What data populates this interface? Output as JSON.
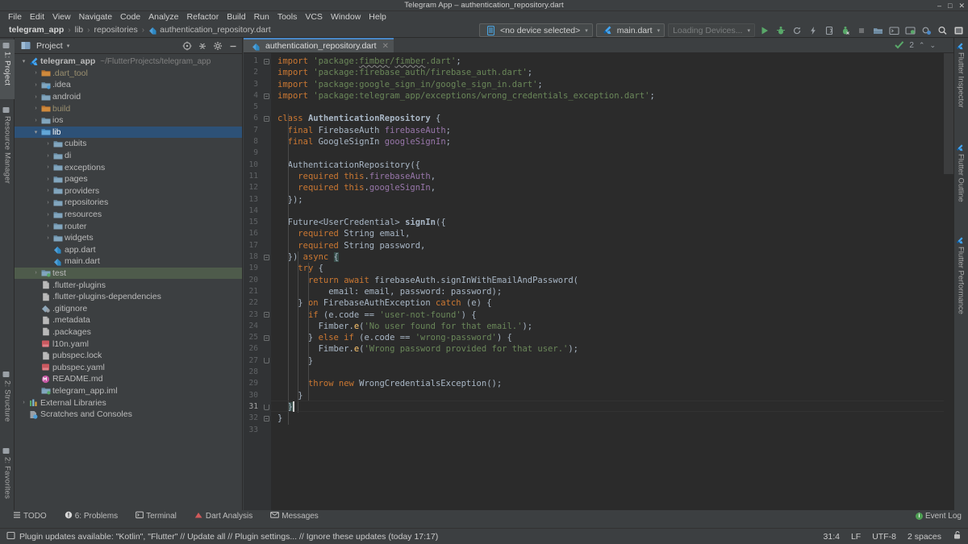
{
  "window": {
    "title": "Telegram App – authentication_repository.dart",
    "controls": [
      "–",
      "□",
      "✕"
    ]
  },
  "menubar": {
    "items": [
      "File",
      "Edit",
      "View",
      "Navigate",
      "Code",
      "Analyze",
      "Refactor",
      "Build",
      "Run",
      "Tools",
      "VCS",
      "Window",
      "Help"
    ]
  },
  "breadcrumb": {
    "items": [
      "telegram_app",
      "lib",
      "repositories",
      "authentication_repository.dart"
    ],
    "separator": "›"
  },
  "toolbar": {
    "device_selector": "<no device selected>",
    "run_config": "main.dart",
    "loading_devices": "Loading Devices...",
    "icons": [
      "run-icon",
      "debug-icon",
      "hot-reload-icon",
      "hot-restart-icon",
      "open-devtools-icon",
      "stop-profile-icon",
      "stop-icon",
      "build-icon",
      "terminal-icon",
      "android-device-icon",
      "settings-sync-icon",
      "search-everywhere-icon",
      "project-structure-icon"
    ],
    "caret": "▾"
  },
  "left_tool_strip": {
    "top": [
      {
        "label": "1: Project",
        "icon": "project-icon",
        "selected": true
      },
      {
        "label": "Resource Manager",
        "icon": "resource-manager-icon",
        "selected": false
      }
    ],
    "bottom": [
      {
        "label": "2: Structure",
        "icon": "structure-icon"
      },
      {
        "label": "2: Favorites",
        "icon": "star-icon"
      }
    ]
  },
  "right_tool_strip": {
    "items": [
      {
        "label": "Flutter Inspector",
        "icon": "flutter-icon"
      },
      {
        "label": "Flutter Outline",
        "icon": "flutter-icon"
      },
      {
        "label": "Flutter Performance",
        "icon": "flutter-icon"
      }
    ]
  },
  "project_panel": {
    "title": "Project",
    "caret": "▾",
    "header_icons": [
      "locate-icon",
      "collapse-all-icon",
      "settings-gear-icon",
      "hide-icon"
    ],
    "tree": [
      {
        "indent": 0,
        "arrow": "▾",
        "icon": "flutter-icon",
        "label": "telegram_app",
        "bold": true,
        "sub": "~/FlutterProjects/telegram_app",
        "state": "none"
      },
      {
        "indent": 1,
        "arrow": "›",
        "icon": "folder-excluded-icon",
        "label": ".dart_tool",
        "dim": true,
        "state": "none"
      },
      {
        "indent": 1,
        "arrow": "›",
        "icon": "folder-idea-icon",
        "label": ".idea",
        "state": "none"
      },
      {
        "indent": 1,
        "arrow": "›",
        "icon": "folder-icon",
        "label": "android",
        "state": "none"
      },
      {
        "indent": 1,
        "arrow": "›",
        "icon": "folder-excluded-icon",
        "label": "build",
        "dim": true,
        "state": "none"
      },
      {
        "indent": 1,
        "arrow": "›",
        "icon": "folder-icon",
        "label": "ios",
        "state": "none"
      },
      {
        "indent": 1,
        "arrow": "▾",
        "icon": "folder-source-icon",
        "label": "lib",
        "state": "selected"
      },
      {
        "indent": 2,
        "arrow": "›",
        "icon": "folder-icon",
        "label": "cubits",
        "state": "none"
      },
      {
        "indent": 2,
        "arrow": "›",
        "icon": "folder-icon",
        "label": "di",
        "state": "none"
      },
      {
        "indent": 2,
        "arrow": "›",
        "icon": "folder-icon",
        "label": "exceptions",
        "state": "none"
      },
      {
        "indent": 2,
        "arrow": "›",
        "icon": "folder-icon",
        "label": "pages",
        "state": "none"
      },
      {
        "indent": 2,
        "arrow": "›",
        "icon": "folder-icon",
        "label": "providers",
        "state": "none"
      },
      {
        "indent": 2,
        "arrow": "›",
        "icon": "folder-icon",
        "label": "repositories",
        "state": "none"
      },
      {
        "indent": 2,
        "arrow": "›",
        "icon": "folder-icon",
        "label": "resources",
        "state": "none"
      },
      {
        "indent": 2,
        "arrow": "›",
        "icon": "folder-icon",
        "label": "router",
        "state": "none"
      },
      {
        "indent": 2,
        "arrow": "›",
        "icon": "folder-icon",
        "label": "widgets",
        "state": "none"
      },
      {
        "indent": 2,
        "arrow": "",
        "icon": "dart-file-icon",
        "label": "app.dart",
        "state": "none"
      },
      {
        "indent": 2,
        "arrow": "",
        "icon": "dart-file-icon",
        "label": "main.dart",
        "state": "none"
      },
      {
        "indent": 1,
        "arrow": "›",
        "icon": "folder-test-icon",
        "label": "test",
        "state": "hover"
      },
      {
        "indent": 1,
        "arrow": "",
        "icon": "text-file-icon",
        "label": ".flutter-plugins",
        "state": "none"
      },
      {
        "indent": 1,
        "arrow": "",
        "icon": "text-file-icon",
        "label": ".flutter-plugins-dependencies",
        "state": "none"
      },
      {
        "indent": 1,
        "arrow": "",
        "icon": "gitignore-icon",
        "label": ".gitignore",
        "state": "none"
      },
      {
        "indent": 1,
        "arrow": "",
        "icon": "text-file-icon",
        "label": ".metadata",
        "state": "none"
      },
      {
        "indent": 1,
        "arrow": "",
        "icon": "text-file-icon",
        "label": ".packages",
        "state": "none"
      },
      {
        "indent": 1,
        "arrow": "",
        "icon": "yaml-file-icon",
        "label": "l10n.yaml",
        "state": "none"
      },
      {
        "indent": 1,
        "arrow": "",
        "icon": "text-file-icon",
        "label": "pubspec.lock",
        "state": "none"
      },
      {
        "indent": 1,
        "arrow": "",
        "icon": "yaml-file-icon",
        "label": "pubspec.yaml",
        "state": "none"
      },
      {
        "indent": 1,
        "arrow": "",
        "icon": "markdown-file-icon",
        "label": "README.md",
        "state": "none"
      },
      {
        "indent": 1,
        "arrow": "",
        "icon": "iml-file-icon",
        "label": "telegram_app.iml",
        "state": "none"
      },
      {
        "indent": 0,
        "arrow": "›",
        "icon": "libraries-icon",
        "label": "External Libraries",
        "state": "none"
      },
      {
        "indent": 0,
        "arrow": "",
        "icon": "scratches-icon",
        "label": "Scratches and Consoles",
        "state": "none"
      }
    ]
  },
  "editor": {
    "tab": {
      "label": "authentication_repository.dart",
      "icon": "dart-file-icon",
      "close": "✕"
    },
    "inspections": {
      "status_icon": "inspections-ok-icon",
      "count": "2",
      "up": "⌃",
      "down": "⌄"
    },
    "first_line": 1,
    "last_line": 33,
    "lines": [
      {
        "n": 1,
        "tokens": [
          {
            "c": "k",
            "t": "import "
          },
          {
            "c": "s",
            "t": "'package:"
          },
          {
            "c": "s und",
            "t": "fimber"
          },
          {
            "c": "s",
            "t": "/"
          },
          {
            "c": "s und",
            "t": "fimber"
          },
          {
            "c": "s",
            "t": ".dart'"
          },
          {
            "c": "t",
            "t": ";"
          }
        ]
      },
      {
        "n": 2,
        "tokens": [
          {
            "c": "k",
            "t": "import "
          },
          {
            "c": "s",
            "t": "'package:firebase_auth/firebase_auth.dart'"
          },
          {
            "c": "t",
            "t": ";"
          }
        ]
      },
      {
        "n": 3,
        "tokens": [
          {
            "c": "k",
            "t": "import "
          },
          {
            "c": "s",
            "t": "'package:google_sign_in/google_sign_in.dart'"
          },
          {
            "c": "t",
            "t": ";"
          }
        ]
      },
      {
        "n": 4,
        "tokens": [
          {
            "c": "k",
            "t": "import "
          },
          {
            "c": "s",
            "t": "'package:telegram_app/exceptions/wrong_credentials_exception.dart'"
          },
          {
            "c": "t",
            "t": ";"
          }
        ]
      },
      {
        "n": 5,
        "tokens": []
      },
      {
        "n": 6,
        "tokens": [
          {
            "c": "k",
            "t": "class "
          },
          {
            "c": "cls",
            "t": "AuthenticationRepository"
          },
          {
            "c": "t",
            "t": " {"
          }
        ]
      },
      {
        "n": 7,
        "tokens": [
          {
            "c": "t",
            "t": "  "
          },
          {
            "c": "k",
            "t": "final "
          },
          {
            "c": "ty",
            "t": "FirebaseAuth "
          },
          {
            "c": "fd",
            "t": "firebaseAuth"
          },
          {
            "c": "t",
            "t": ";"
          }
        ]
      },
      {
        "n": 8,
        "tokens": [
          {
            "c": "t",
            "t": "  "
          },
          {
            "c": "k",
            "t": "final "
          },
          {
            "c": "ty",
            "t": "GoogleSignIn "
          },
          {
            "c": "fd",
            "t": "googleSignIn"
          },
          {
            "c": "t",
            "t": ";"
          }
        ]
      },
      {
        "n": 9,
        "tokens": []
      },
      {
        "n": 10,
        "tokens": [
          {
            "c": "t",
            "t": "  AuthenticationRepository({"
          }
        ]
      },
      {
        "n": 11,
        "tokens": [
          {
            "c": "t",
            "t": "    "
          },
          {
            "c": "k",
            "t": "required "
          },
          {
            "c": "k",
            "t": "this"
          },
          {
            "c": "t",
            "t": "."
          },
          {
            "c": "fd",
            "t": "firebaseAuth"
          },
          {
            "c": "t",
            "t": ","
          }
        ]
      },
      {
        "n": 12,
        "tokens": [
          {
            "c": "t",
            "t": "    "
          },
          {
            "c": "k",
            "t": "required "
          },
          {
            "c": "k",
            "t": "this"
          },
          {
            "c": "t",
            "t": "."
          },
          {
            "c": "fd",
            "t": "googleSignIn"
          },
          {
            "c": "t",
            "t": ","
          }
        ]
      },
      {
        "n": 13,
        "tokens": [
          {
            "c": "t",
            "t": "  });"
          }
        ]
      },
      {
        "n": 14,
        "tokens": []
      },
      {
        "n": 15,
        "tokens": [
          {
            "c": "t",
            "t": "  "
          },
          {
            "c": "ty",
            "t": "Future<UserCredential> "
          },
          {
            "c": "cls",
            "t": "signIn"
          },
          {
            "c": "t",
            "t": "({"
          }
        ]
      },
      {
        "n": 16,
        "tokens": [
          {
            "c": "t",
            "t": "    "
          },
          {
            "c": "k",
            "t": "required "
          },
          {
            "c": "ty",
            "t": "String "
          },
          {
            "c": "t",
            "t": "email,"
          }
        ]
      },
      {
        "n": 17,
        "tokens": [
          {
            "c": "t",
            "t": "    "
          },
          {
            "c": "k",
            "t": "required "
          },
          {
            "c": "ty",
            "t": "String "
          },
          {
            "c": "t",
            "t": "password,"
          }
        ]
      },
      {
        "n": 18,
        "tokens": [
          {
            "c": "t",
            "t": "  }) "
          },
          {
            "c": "k",
            "t": "async "
          },
          {
            "c": "brgreen",
            "t": "{"
          }
        ]
      },
      {
        "n": 19,
        "tokens": [
          {
            "c": "t",
            "t": "    "
          },
          {
            "c": "k",
            "t": "try"
          },
          {
            "c": "t",
            "t": " {"
          }
        ]
      },
      {
        "n": 20,
        "tokens": [
          {
            "c": "t",
            "t": "      "
          },
          {
            "c": "k",
            "t": "return "
          },
          {
            "c": "k",
            "t": "await "
          },
          {
            "c": "t",
            "t": "firebaseAuth.signInWithEmailAndPassword("
          }
        ]
      },
      {
        "n": 21,
        "tokens": [
          {
            "c": "t",
            "t": "          email: email, password: password);"
          }
        ]
      },
      {
        "n": 22,
        "tokens": [
          {
            "c": "t",
            "t": "    } "
          },
          {
            "c": "k",
            "t": "on "
          },
          {
            "c": "t",
            "t": "FirebaseAuthException "
          },
          {
            "c": "k",
            "t": "catch "
          },
          {
            "c": "t",
            "t": "(e) {"
          }
        ]
      },
      {
        "n": 23,
        "tokens": [
          {
            "c": "t",
            "t": "      "
          },
          {
            "c": "k",
            "t": "if "
          },
          {
            "c": "t",
            "t": "(e.code == "
          },
          {
            "c": "s",
            "t": "'user-not-found'"
          },
          {
            "c": "t",
            "t": ") {"
          }
        ]
      },
      {
        "n": 24,
        "tokens": [
          {
            "c": "t",
            "t": "        Fimber."
          },
          {
            "c": "fn",
            "t": "e"
          },
          {
            "c": "t",
            "t": "("
          },
          {
            "c": "s",
            "t": "'No user found for that email.'"
          },
          {
            "c": "t",
            "t": ");"
          }
        ]
      },
      {
        "n": 25,
        "tokens": [
          {
            "c": "t",
            "t": "      } "
          },
          {
            "c": "k",
            "t": "else if "
          },
          {
            "c": "t",
            "t": "(e.code == "
          },
          {
            "c": "s",
            "t": "'wrong-password'"
          },
          {
            "c": "t",
            "t": ") {"
          }
        ]
      },
      {
        "n": 26,
        "tokens": [
          {
            "c": "t",
            "t": "        Fimber."
          },
          {
            "c": "fn",
            "t": "e"
          },
          {
            "c": "t",
            "t": "("
          },
          {
            "c": "s",
            "t": "'Wrong password provided for that user.'"
          },
          {
            "c": "t",
            "t": ");"
          }
        ]
      },
      {
        "n": 27,
        "tokens": [
          {
            "c": "t",
            "t": "      }"
          }
        ]
      },
      {
        "n": 28,
        "tokens": []
      },
      {
        "n": 29,
        "tokens": [
          {
            "c": "t",
            "t": "      "
          },
          {
            "c": "k",
            "t": "throw new "
          },
          {
            "c": "ty",
            "t": "WrongCredentialsException"
          },
          {
            "c": "t",
            "t": "();"
          }
        ]
      },
      {
        "n": 30,
        "tokens": [
          {
            "c": "t",
            "t": "    }"
          }
        ]
      },
      {
        "n": 31,
        "tokens": [
          {
            "c": "t",
            "t": "  "
          },
          {
            "c": "brgreen",
            "t": "}"
          }
        ]
      },
      {
        "n": 32,
        "tokens": [
          {
            "c": "t",
            "t": "}"
          }
        ]
      },
      {
        "n": 33,
        "tokens": []
      }
    ]
  },
  "bottom_tool_bar": {
    "items": [
      {
        "label": "TODO",
        "icon": "todo-icon",
        "badge": ""
      },
      {
        "label": "6: Problems",
        "icon": "problems-icon",
        "badge": ""
      },
      {
        "label": "Terminal",
        "icon": "terminal-icon",
        "badge": ""
      },
      {
        "label": "Dart Analysis",
        "icon": "dart-analysis-icon",
        "badge": ""
      },
      {
        "label": "Messages",
        "icon": "messages-icon",
        "badge": ""
      }
    ],
    "event_log": {
      "label": "Event Log",
      "icon": "event-log-icon"
    }
  },
  "status_bar": {
    "icon": "notification-icon",
    "message": "Plugin updates available: \"Kotlin\", \"Flutter\" // Update all // Plugin settings... // Ignore these updates (today 17:17)",
    "caret_position": "31:4",
    "line_separator": "LF",
    "encoding": "UTF-8",
    "indent": "2 spaces",
    "lock_icon": "read-write-lock-icon"
  },
  "colors": {
    "accent_blue": "#4a88c7",
    "selection_blue": "#2d5177",
    "panel_bg": "#3c3f41",
    "editor_bg": "#2b2b2b",
    "gutter_bg": "#313335",
    "keyword_orange": "#cc7832",
    "string_green": "#6a8759",
    "field_purple": "#9876aa",
    "method_yellow": "#ffc66d",
    "run_green": "#4f9f54"
  }
}
